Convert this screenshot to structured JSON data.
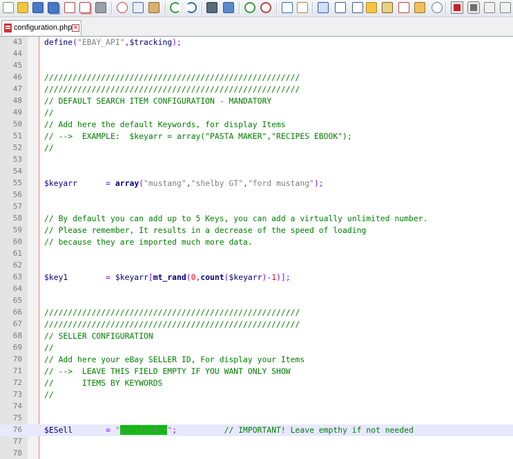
{
  "toolbar": {
    "icons": [
      "new-icon",
      "open-icon",
      "save-icon",
      "save-all-icon",
      "close-icon",
      "close-all-icon",
      "print-icon",
      "cut-icon",
      "copy-icon",
      "paste-icon",
      "undo-icon",
      "redo-icon",
      "find-icon",
      "replace-icon",
      "zoom-in-icon",
      "zoom-out-icon",
      "sync-vertical-icon",
      "sync-horizontal-icon",
      "word-wrap-icon",
      "show-all-chars-icon",
      "indent-guide-icon",
      "user-lang-icon",
      "doc-map-icon",
      "function-list-icon",
      "folder-icon",
      "monitor-icon",
      "record-macro-icon",
      "stop-macro-icon",
      "play-macro-icon",
      "run-macro-multiple-icon"
    ]
  },
  "tab": {
    "filename": "configuration.php",
    "close": "✕"
  },
  "lines": {
    "l43": "43",
    "l44": "44",
    "l45": "45",
    "l46": "46",
    "l47": "47",
    "l48": "48",
    "l49": "49",
    "l50": "50",
    "l51": "51",
    "l52": "52",
    "l53": "53",
    "l54": "54",
    "l55": "55",
    "l56": "56",
    "l57": "57",
    "l58": "58",
    "l59": "59",
    "l60": "60",
    "l61": "61",
    "l62": "62",
    "l63": "63",
    "l64": "64",
    "l65": "65",
    "l66": "66",
    "l67": "67",
    "l68": "68",
    "l69": "69",
    "l70": "70",
    "l71": "71",
    "l72": "72",
    "l73": "73",
    "l74": "74",
    "l75": "75",
    "l76": "76",
    "l77": "77",
    "l78": "78"
  },
  "code": {
    "c43_fn": "define",
    "c43_a": "(",
    "c43_str": "\"EBAY_API\"",
    "c43_b": ",",
    "c43_var": "$tracking",
    "c43_c": ");",
    "c46": "//////////////////////////////////////////////////////",
    "c47": "//////////////////////////////////////////////////////",
    "c48": "// DEFAULT SEARCH ITEM CONFIGURATION - MANDATORY",
    "c49": "//",
    "c50": "// Add here the default Keywords, for display Items",
    "c51": "// -->  EXAMPLE:  $keyarr = array(\"PASTA MAKER\",\"RECIPES EBOOK\");",
    "c52": "//",
    "c55_var": "$keyarr",
    "c55_op": "      = ",
    "c55_fn": "array",
    "c55_a": "(",
    "c55_s1": "\"mustang\"",
    "c55_b": ",",
    "c55_s2": "\"shelby GT\"",
    "c55_c": ",",
    "c55_s3": "\"ford mustang\"",
    "c55_d": ");",
    "c58": "// By default you can add up to 5 Keys, you can add a virtually unlimited number.",
    "c59": "// Please remember, It results in a decrease of the speed of loading",
    "c60": "// because they are imported much more data.",
    "c63_var": "$key1",
    "c63_op": "        = ",
    "c63_var2": "$keyarr",
    "c63_a": "[",
    "c63_fn": "mt_rand",
    "c63_b": "(",
    "c63_n0": "0",
    "c63_c": ",",
    "c63_fn2": "count",
    "c63_d": "(",
    "c63_var3": "$keyarr",
    "c63_e": ")-",
    "c63_n1": "1",
    "c63_f": ")];",
    "c66": "//////////////////////////////////////////////////////",
    "c67": "//////////////////////////////////////////////////////",
    "c68": "// SELLER CONFIGURATION",
    "c69": "//",
    "c70": "// Add here your eBay SELLER ID, For display your Items",
    "c71": "// -->  LEAVE THIS FIELD EMPTY IF YOU WANT ONLY SHOW",
    "c72": "//      ITEMS BY KEYWORDS",
    "c73": "//",
    "c76_var": "$ESell",
    "c76_op": "       = ",
    "c76_q1": "\"",
    "c76_hl": "getafordtn",
    "c76_q2": "\"",
    "c76_semi": ";",
    "c76_cm": "          // IMPORTANT! Leave empthy if not needed"
  },
  "colors": {
    "comment": "#008000",
    "string": "#808080",
    "variable": "#000080",
    "number": "#ff0000",
    "operator": "#8000ff",
    "highlight": "#00c000"
  }
}
